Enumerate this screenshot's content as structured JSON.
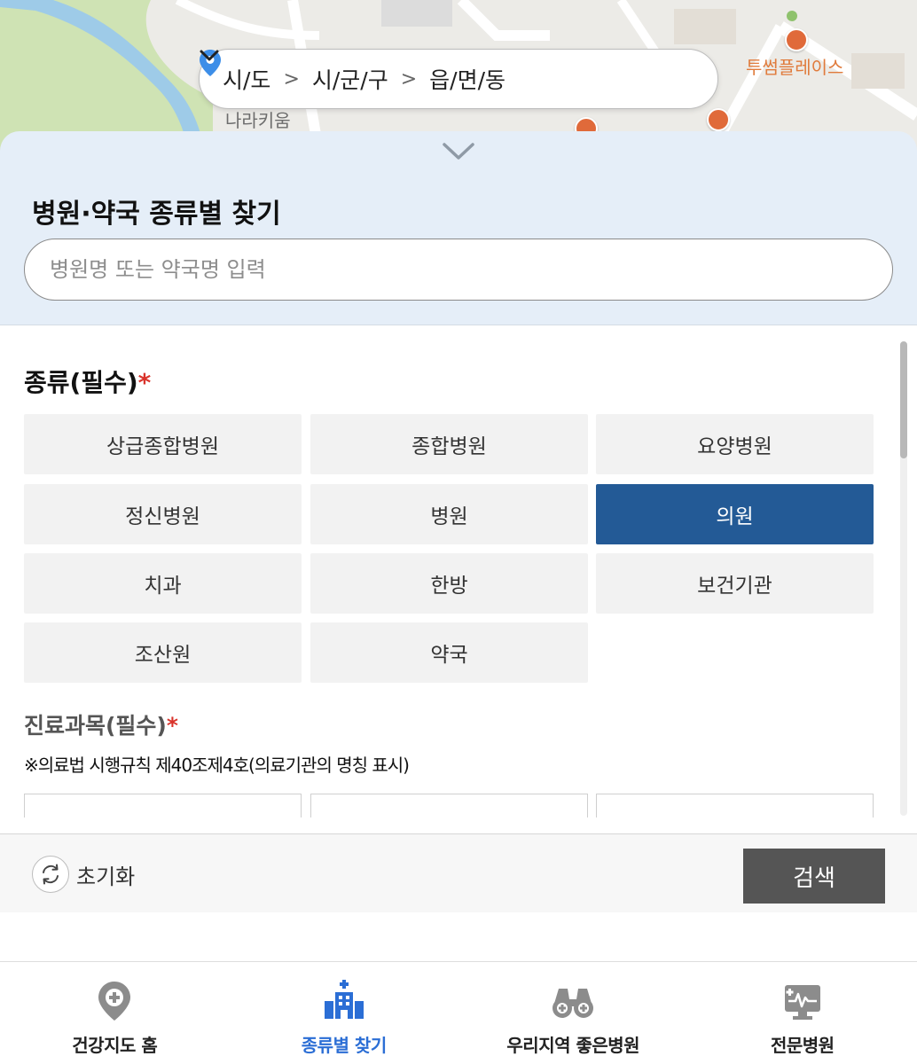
{
  "map": {
    "labels": {
      "place1": "나라키움",
      "place2": "투썸플레이스"
    }
  },
  "location_selector": {
    "sido": "시/도",
    "sigungu": "시/군/구",
    "eupmyeondong": "읍/면/동",
    "separator": ">"
  },
  "sheet": {
    "title": "병원·약국 종류별 찾기",
    "search_placeholder": "병원명 또는 약국명 입력",
    "search_value": ""
  },
  "category_section": {
    "title": "종류(필수)",
    "required_mark": "*",
    "items": [
      {
        "label": "상급종합병원",
        "selected": false
      },
      {
        "label": "종합병원",
        "selected": false
      },
      {
        "label": "요양병원",
        "selected": false
      },
      {
        "label": "정신병원",
        "selected": false
      },
      {
        "label": "병원",
        "selected": false
      },
      {
        "label": "의원",
        "selected": true
      },
      {
        "label": "치과",
        "selected": false
      },
      {
        "label": "한방",
        "selected": false
      },
      {
        "label": "보건기관",
        "selected": false
      },
      {
        "label": "조산원",
        "selected": false
      },
      {
        "label": "약국",
        "selected": false
      }
    ]
  },
  "subject_section": {
    "title": "진료과목(필수)",
    "required_mark": "*",
    "note": "※의료법 시행규칙 제40조제4호(의료기관의 명칭 표시)"
  },
  "actions": {
    "reset_label": "초기화",
    "search_label": "검색"
  },
  "bottom_nav": {
    "items": [
      {
        "label": "건강지도 홈",
        "icon": "map-pin-plus-icon",
        "active": false
      },
      {
        "label": "종류별 찾기",
        "icon": "hospital-building-icon",
        "active": true
      },
      {
        "label": "우리지역 좋은병원",
        "icon": "binoculars-icon",
        "active": false
      },
      {
        "label": "전문병원",
        "icon": "monitor-heartbeat-icon",
        "active": false
      }
    ]
  },
  "colors": {
    "accent": "#235a96",
    "nav_active": "#2b6ed5",
    "required": "#d9332b",
    "sheet_header_bg": "#e5eef8",
    "search_button_bg": "#555555"
  }
}
